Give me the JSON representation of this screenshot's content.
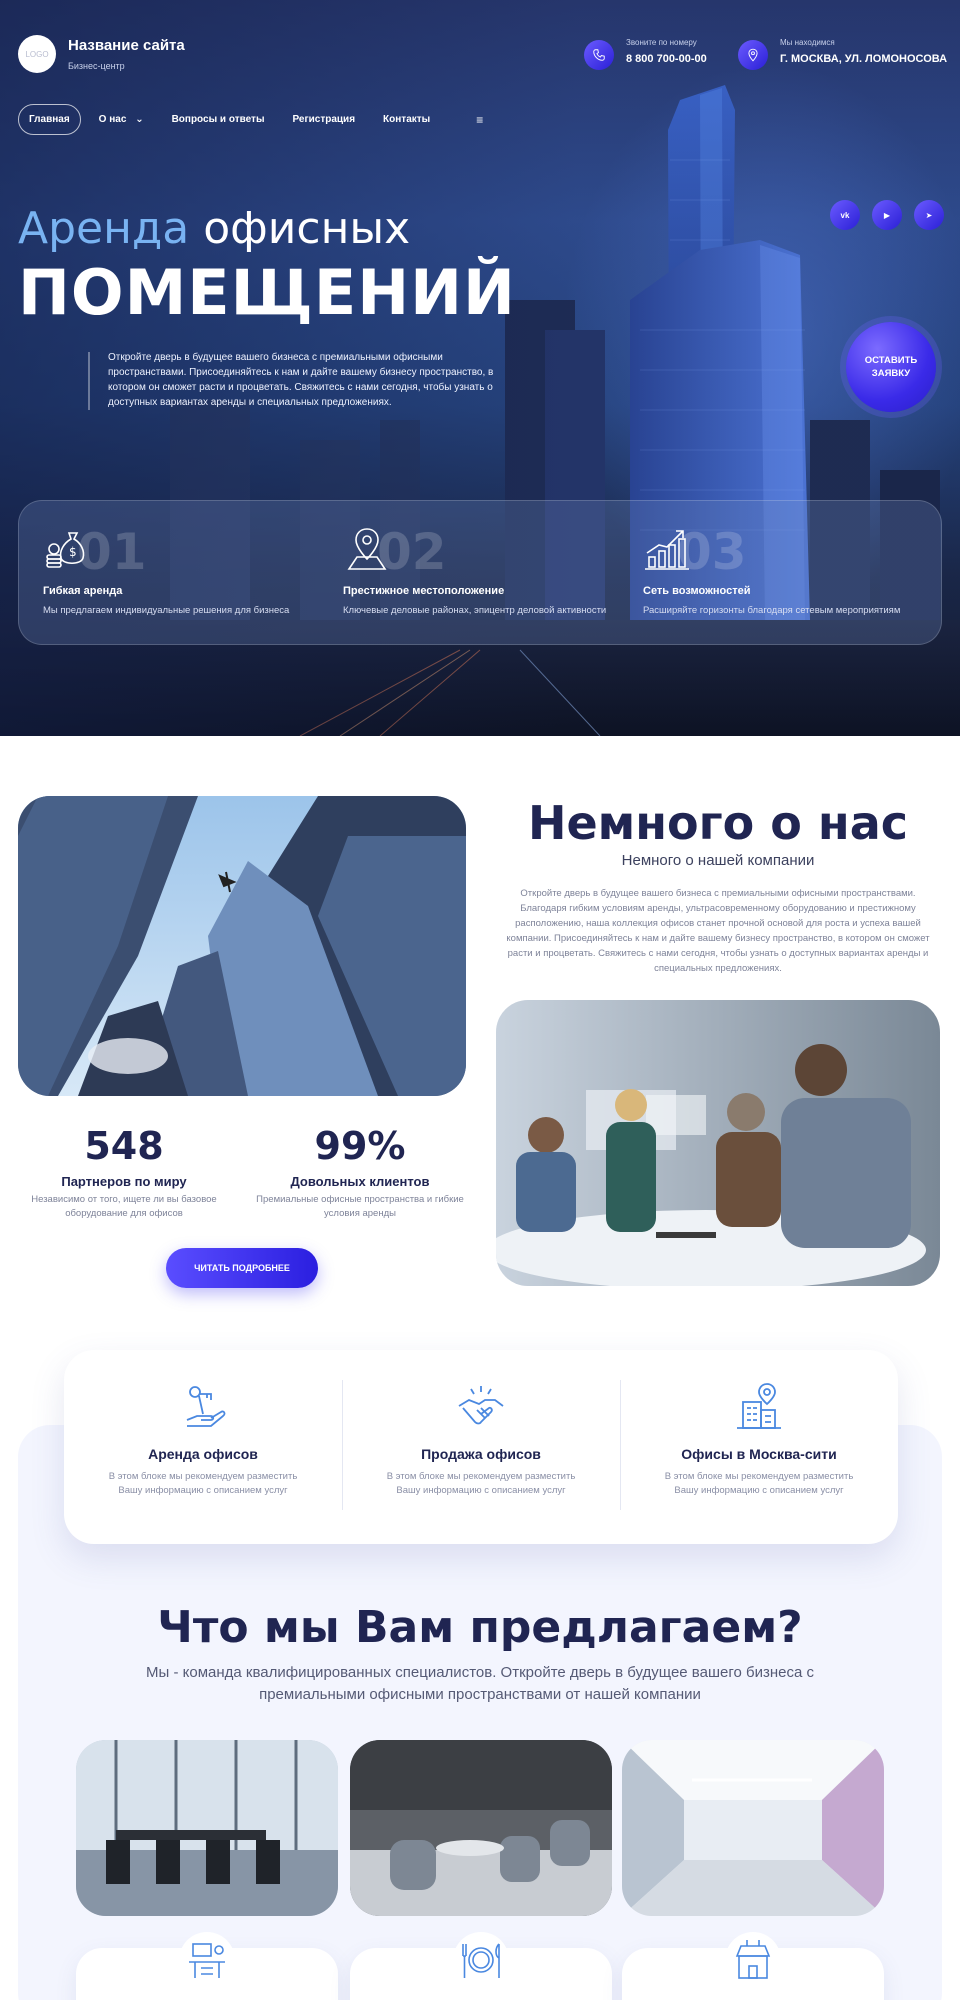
{
  "header": {
    "logo_text": "LOGO",
    "site_title": "Название сайта",
    "site_subtitle": "Бизнес-центр",
    "phone_label": "Звоните по номеру",
    "phone_value": "8 800 700-00-00",
    "location_label": "Мы находимся",
    "location_value": "Г. МОСКВА, УЛ. ЛОМОНОСОВА"
  },
  "nav": {
    "items": [
      {
        "label": "Главная"
      },
      {
        "label": "О нас"
      },
      {
        "label": "Вопросы и ответы"
      },
      {
        "label": "Регистрация"
      },
      {
        "label": "Контакты"
      }
    ],
    "about_chevron": "⌄",
    "menu_glyph": "≡"
  },
  "socials": [
    {
      "icon": "vk-icon",
      "label": "vk"
    },
    {
      "icon": "youtube-icon",
      "label": "▶"
    },
    {
      "icon": "telegram-icon",
      "label": "➤"
    }
  ],
  "hero": {
    "title_accent": "Аренда",
    "title_rest": " офисных",
    "title_line2": "ПОМЕЩЕНИЙ",
    "description": "Откройте дверь в будущее вашего бизнеса с премиальными офисными пространствами. Присоединяйтесь к нам и дайте вашему бизнесу пространство, в котором он сможет расти и процветать. Свяжитесь с нами сегодня, чтобы узнать о доступных вариантах аренды и специальных предложениях.",
    "cta": "ОСТАВИТЬ ЗАЯВКУ"
  },
  "features": [
    {
      "num": "01",
      "icon": "money-bag-icon",
      "title": "Гибкая аренда",
      "desc": "Мы предлагаем индивидуальные решения для бизнеса"
    },
    {
      "num": "02",
      "icon": "map-pin-icon",
      "title": "Престижное местоположение",
      "desc": "Ключевые деловые районах, эпицентр деловой активности"
    },
    {
      "num": "03",
      "icon": "growth-chart-icon",
      "title": "Сеть возможностей",
      "desc": "Расширяйте горизонты благодаря сетевым мероприятиям"
    }
  ],
  "about": {
    "title": "Немного о нас",
    "subtitle": "Немного о нашей компании",
    "text": "Откройте дверь в будущее вашего бизнеса с премиальными офисными пространствами. Благодаря гибким условиям аренды, ультрасовременному оборудованию и престижному расположению, наша коллекция офисов станет прочной основой для роста и успеха вашей компании. Присоединяйтесь к нам и дайте вашему бизнесу пространство, в котором он сможет расти и процветать. Свяжитесь с нами сегодня, чтобы узнать о доступных вариантах аренды и специальных предложениях.",
    "stats": [
      {
        "value": "548",
        "label": "Партнеров по миру",
        "desc": "Независимо от того, ищете ли вы базовое оборудование для офисов"
      },
      {
        "value": "99%",
        "label": "Довольных клиентов",
        "desc": "Премиальные офисные пространства и гибкие условия аренды"
      }
    ],
    "read_more": "ЧИТАТЬ ПОДРОБНЕЕ"
  },
  "services": [
    {
      "icon": "hand-key-icon",
      "title": "Аренда офисов",
      "desc": "В этом блоке мы рекомендуем разместить Вашу информацию с описанием услуг"
    },
    {
      "icon": "handshake-icon",
      "title": "Продажа офисов",
      "desc": "В этом блоке мы рекомендуем разместить Вашу информацию с описанием услуг"
    },
    {
      "icon": "building-pin-icon",
      "title": "Офисы в Москва-сити",
      "desc": "В этом блоке мы рекомендуем разместить Вашу информацию с описанием услуг"
    }
  ],
  "offer": {
    "title": "Что мы Вам предлагаем?",
    "subtitle": "Мы - команда квалифицированных специалистов. Откройте дверь в будущее вашего бизнеса с премиальными офисными пространствами от нашей компании",
    "cards": [
      {
        "icon": "workspace-icon"
      },
      {
        "icon": "dining-icon"
      },
      {
        "icon": "shop-icon"
      }
    ]
  },
  "colors": {
    "accent": "#3a2ae8",
    "heading": "#202552",
    "icon_blue": "#4a88e0",
    "hero_light": "#79b3f2"
  }
}
